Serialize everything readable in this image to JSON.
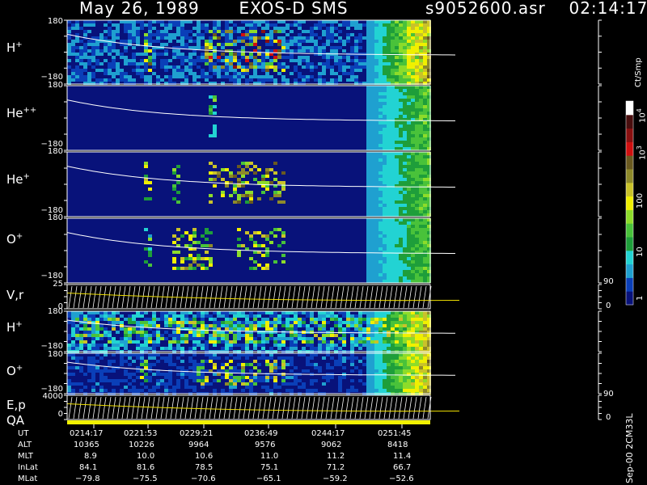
{
  "header": {
    "date": "May 26, 1989",
    "instrument": "EXOS-D SMS",
    "file": "s9052600.asr",
    "time": "02:14:17"
  },
  "colorbar": {
    "label": "Ct/Smp",
    "ticks": [
      "1",
      "10",
      "100",
      "10",
      "10"
    ],
    "tick_exponents": [
      "",
      "",
      "",
      "3",
      "4"
    ],
    "colors": [
      "#08127a",
      "#0a3fb8",
      "#1fa0d0",
      "#22d3d3",
      "#1e9e3a",
      "#49c23a",
      "#8ddc2a",
      "#f0f000",
      "#c9c22a",
      "#8e8a2a",
      "#6a5a20",
      "#d01010",
      "#8a1010",
      "#4a0f0f",
      "#ffffff"
    ]
  },
  "panels": [
    {
      "id": "h-plus",
      "species": "H",
      "charge": "+",
      "ymax": "180",
      "ymin": "−180"
    },
    {
      "id": "he-plus-plus",
      "species": "He",
      "charge": "++",
      "ymax": "180",
      "ymin": "−180"
    },
    {
      "id": "he-plus",
      "species": "He",
      "charge": "+",
      "ymax": "180",
      "ymin": "−180"
    },
    {
      "id": "o-plus",
      "species": "O",
      "charge": "+",
      "ymax": "180",
      "ymin": "−180"
    },
    {
      "id": "vr",
      "species": "V,r",
      "charge": "",
      "ymax": "25",
      "ymin": "0",
      "right_ticks": [
        "90",
        "0"
      ]
    },
    {
      "id": "h-plus-2",
      "species": "H",
      "charge": "+",
      "ymax": "180",
      "ymin": "−180"
    },
    {
      "id": "o-plus-2",
      "species": "O",
      "charge": "+",
      "ymax": "180",
      "ymin": "−180"
    },
    {
      "id": "ep",
      "species": "E,p",
      "charge": "",
      "ymax": "4000",
      "ymin": "0",
      "right_ticks": [
        "90",
        "0"
      ]
    }
  ],
  "qa_label": "QA",
  "orbit": {
    "row_labels": [
      "UT",
      "ALT",
      "MLT",
      "InLat",
      "MLat"
    ],
    "columns": [
      {
        "UT": "0214:17",
        "ALT": "10365",
        "MLT": "8.9",
        "InLat": "84.1",
        "MLat": "−79.8"
      },
      {
        "UT": "0221:53",
        "ALT": "10226",
        "MLT": "10.0",
        "InLat": "81.6",
        "MLat": "−75.5"
      },
      {
        "UT": "0229:21",
        "ALT": "9964",
        "MLT": "10.6",
        "InLat": "78.5",
        "MLat": "−70.6"
      },
      {
        "UT": "0236:49",
        "ALT": "9576",
        "MLT": "11.0",
        "InLat": "75.1",
        "MLat": "−65.1"
      },
      {
        "UT": "0244:17",
        "ALT": "9062",
        "MLT": "11.2",
        "InLat": "71.2",
        "MLat": "−59.2"
      },
      {
        "UT": "0251:45",
        "ALT": "8418",
        "MLT": "11.4",
        "InLat": "66.7",
        "MLat": "−52.6"
      }
    ]
  },
  "footer_vertical": "Sep-00 2CM33L",
  "chart_data": {
    "type": "heatmap",
    "title": "May 26, 1989   EXOS-D SMS",
    "x_ticks": [
      "0214:17",
      "0221:53",
      "0229:21",
      "0236:49",
      "0244:17",
      "0251:45"
    ],
    "series": [
      {
        "name": "H+",
        "ylim": [
          -180,
          180
        ]
      },
      {
        "name": "He++",
        "ylim": [
          -180,
          180
        ]
      },
      {
        "name": "He+",
        "ylim": [
          -180,
          180
        ]
      },
      {
        "name": "O+",
        "ylim": [
          -180,
          180
        ]
      },
      {
        "name": "V,r",
        "ylim": [
          0,
          25
        ]
      },
      {
        "name": "H+",
        "ylim": [
          -180,
          180
        ]
      },
      {
        "name": "O+",
        "ylim": [
          -180,
          180
        ]
      },
      {
        "name": "E,p",
        "ylim": [
          0,
          4000
        ]
      }
    ],
    "colorbar_range": [
      1,
      10000
    ],
    "colorbar_scale": "log",
    "colorbar_unit": "Ct/Smp"
  }
}
